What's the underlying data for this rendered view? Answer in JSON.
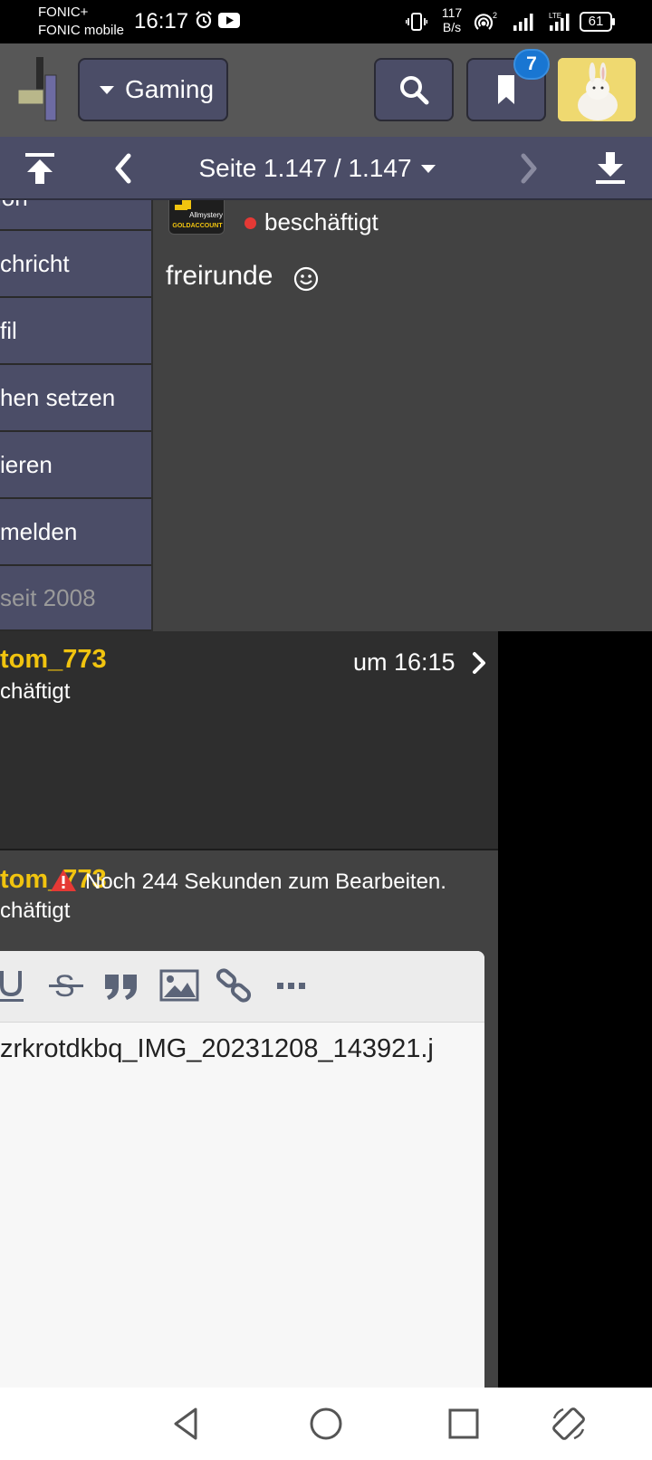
{
  "status_bar": {
    "carrier_line1": "FONIC+",
    "carrier_line2": "FONIC mobile",
    "time": "16:17",
    "net_speed_value": "117",
    "net_speed_unit": "B/s",
    "battery": "61",
    "icons": [
      "alarm-icon",
      "youtube-icon",
      "vibrate-icon",
      "hotspot-icon",
      "signal-icon",
      "battery-icon"
    ]
  },
  "header": {
    "category": "Gaming",
    "bookmark_count": "7"
  },
  "page_nav": {
    "page_label": "Seite 1.147 / 1.147"
  },
  "side_menu": {
    "items": [
      {
        "label": "ion"
      },
      {
        "label": "chricht"
      },
      {
        "label": "fil"
      },
      {
        "label": "hen setzen"
      },
      {
        "label": "ieren"
      },
      {
        "label": "melden"
      },
      {
        "label": "seit 2008"
      }
    ]
  },
  "post1": {
    "badge_brand": "Allmystery",
    "badge_sub": "GOLDACCOUNT",
    "status": "beschäftigt",
    "text": "freirunde"
  },
  "post2": {
    "username": "tom_773",
    "status": "chäftigt",
    "time": "um 16:15"
  },
  "editor": {
    "username": "tom_773",
    "status": "chäftigt",
    "edit_note": "Noch 244 Sekunden zum Bearbeiten.",
    "content": "zrkrotdkbq_IMG_20231208_143921.j",
    "toolbar": [
      "underline-icon",
      "strikethrough-icon",
      "quote-icon",
      "image-icon",
      "link-icon",
      "more-icon"
    ]
  },
  "colors": {
    "accent_button": "#4b4d67",
    "username": "#f1c40f",
    "status_dot": "#e53935",
    "badge": "#1976d2"
  }
}
